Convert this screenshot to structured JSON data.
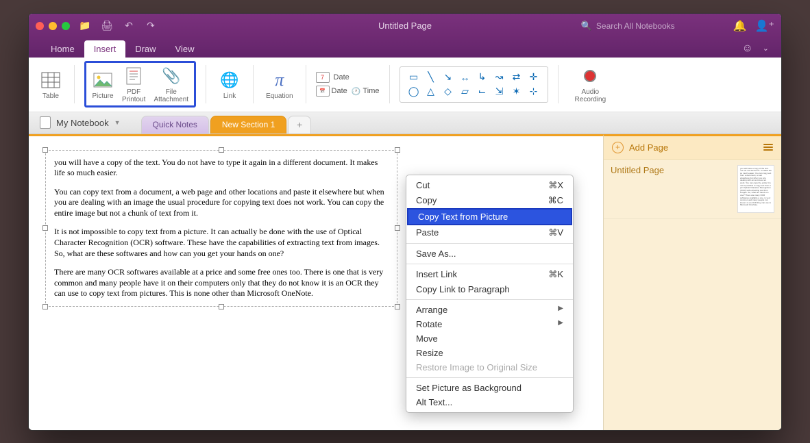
{
  "window": {
    "title": "Untitled Page"
  },
  "search": {
    "placeholder": "Search All Notebooks"
  },
  "menus": {
    "home": "Home",
    "insert": "Insert",
    "draw": "Draw",
    "view": "View"
  },
  "ribbon": {
    "table": "Table",
    "picture": "Picture",
    "pdf_printout": "PDF\nPrintout",
    "file_attachment": "File\nAttachment",
    "link": "Link",
    "equation_symbol": "π",
    "equation": "Equation",
    "date_num": "7",
    "date_label": "Date",
    "date_icon_label": "Date",
    "time_label": "Time",
    "audio": "Audio\nRecording"
  },
  "notebook": {
    "name": "My Notebook"
  },
  "tabs": {
    "quick": "Quick Notes",
    "section1": "New Section 1",
    "add": "+"
  },
  "paragraphs": {
    "p1": "you will have a copy of the text. You do not have to type it again in a different document. It makes life so much easier.",
    "p2": "You can copy text from a document, a web page and other locations and paste it elsewhere but when you are dealing with an image the usual procedure for copying text does not work. You can copy the entire image but not a chunk of text from it.",
    "p3": "It is not impossible to copy text from a picture. It can actually be done with the use of Optical Character Recognition (OCR) software. These have the capabilities of extracting text from images. So, what are these softwares and how can you get your hands on one?",
    "p4": "There are many OCR softwares available at a price and some free ones too. There is one that is very common and many people have it on their computers only that they do not know it is an OCR they can use to copy text from pictures. This is none other than Microsoft OneNote."
  },
  "context_menu": {
    "cut": "Cut",
    "cut_k": "⌘X",
    "copy": "Copy",
    "copy_k": "⌘C",
    "copy_text": "Copy Text from Picture",
    "paste": "Paste",
    "paste_k": "⌘V",
    "save_as": "Save As...",
    "insert_link": "Insert Link",
    "insert_link_k": "⌘K",
    "copy_link": "Copy Link to Paragraph",
    "arrange": "Arrange",
    "rotate": "Rotate",
    "move": "Move",
    "resize": "Resize",
    "restore": "Restore Image to Original Size",
    "set_bg": "Set Picture as Background",
    "alt_text": "Alt Text..."
  },
  "sidebar": {
    "add_page": "Add Page",
    "pages": [
      {
        "title": "Untitled Page"
      }
    ]
  },
  "thumb_text": "you will have a copy of the text. You do not document. It makes life so much easier. You can copy text from a document, a web elsewhere but when you are dealing with an text does not work. You can copy the entire It is not impossible to copy text from a pic Optical Character Recognition (OCR) soft extracting text from images. So, what are hands on one? There are many OCR softwares available a one. is very common and many people not know it is an OCR they can use to Microsoft OneNote."
}
